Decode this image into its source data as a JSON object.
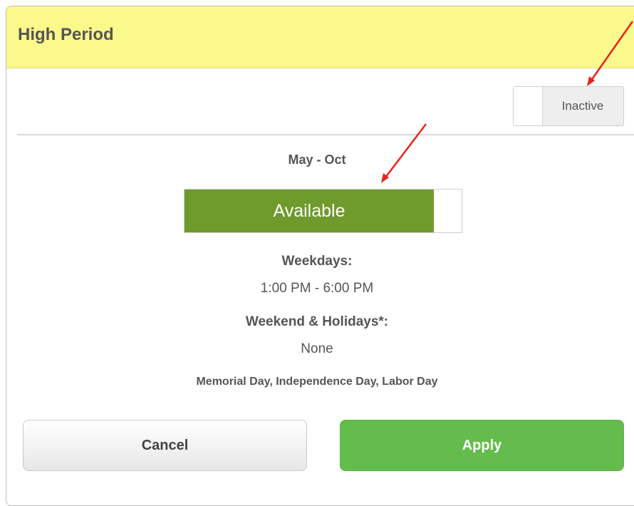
{
  "dialog": {
    "title": "High Period",
    "header_color": "#fbf88c"
  },
  "status_toggle": {
    "label": "Inactive"
  },
  "season": {
    "range": "May - Oct"
  },
  "availability": {
    "label": "Available",
    "color": "#6f9a2c"
  },
  "schedule": {
    "weekdays_label": "Weekdays:",
    "weekdays_hours": "1:00 PM - 6:00 PM",
    "weekend_label": "Weekend & Holidays*:",
    "weekend_hours": "None",
    "holidays_note": "Memorial Day, Independence Day, Labor Day"
  },
  "buttons": {
    "cancel_label": "Cancel",
    "apply_label": "Apply",
    "apply_color": "#63bc4b"
  },
  "annotations": {
    "arrow_color": "#e8231c"
  }
}
